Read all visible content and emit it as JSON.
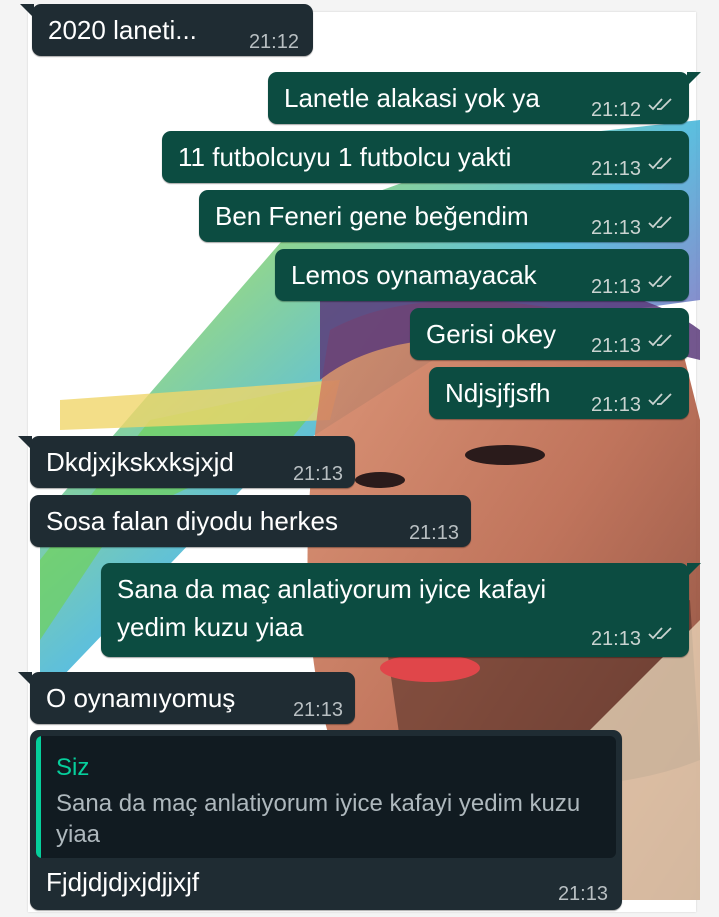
{
  "chat": {
    "messages": [
      {
        "direction": "incoming",
        "text": "2020 laneti...",
        "time": "21:12"
      },
      {
        "direction": "outgoing",
        "text": "Lanetle alakasi yok ya",
        "time": "21:12",
        "status": "read"
      },
      {
        "direction": "outgoing",
        "text": "11 futbolcuyu 1 futbolcu yakti",
        "time": "21:13",
        "status": "read"
      },
      {
        "direction": "outgoing",
        "text": "Ben Feneri gene beğendim",
        "time": "21:13",
        "status": "read"
      },
      {
        "direction": "outgoing",
        "text": "Lemos oynamayacak",
        "time": "21:13",
        "status": "read"
      },
      {
        "direction": "outgoing",
        "text": "Gerisi okey",
        "time": "21:13",
        "status": "read"
      },
      {
        "direction": "outgoing",
        "text": "Ndjsjfjsfh",
        "time": "21:13",
        "status": "read"
      },
      {
        "direction": "incoming",
        "text": "Dkdjxjkskxksjxjd",
        "time": "21:13"
      },
      {
        "direction": "incoming",
        "text": "Sosa falan diyodu herkes",
        "time": "21:13"
      },
      {
        "direction": "outgoing",
        "text_line1": "Sana da maç anlatiyorum iyice kafayi",
        "text_line2": "yedim kuzu yiaa",
        "time": "21:13",
        "status": "read"
      },
      {
        "direction": "incoming",
        "text": "O oynamıyomuş",
        "time": "21:13"
      },
      {
        "direction": "incoming",
        "reply": {
          "author": "Siz",
          "text": "Sana da maç anlatiyorum iyice kafayi yedim kuzu yiaa"
        },
        "text": "Fjdjdjdjxjdjjxjf",
        "time": "21:13"
      }
    ]
  },
  "colors": {
    "outgoing_bubble": "#0c4c41",
    "incoming_bubble": "#1f2c33",
    "quote_accent": "#06cf9c",
    "read_ticks": "#c9d3d0"
  },
  "icons": {
    "read_status": "double-check-icon"
  }
}
